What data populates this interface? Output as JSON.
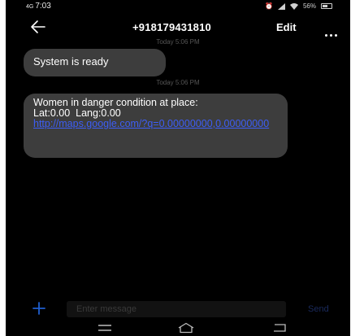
{
  "status_bar": {
    "network": "4G",
    "time": "7:03",
    "battery_text": "56%",
    "battery_level": 0.56
  },
  "header": {
    "contact": "+918179431810",
    "edit_label": "Edit",
    "back_icon": "arrow-left-icon",
    "more_icon": "more-horizontal-icon"
  },
  "messages": [
    {
      "timestamp": "Today 5:06 PM",
      "text": "System is ready"
    },
    {
      "timestamp": "Today 5:06 PM",
      "line1": "Women in danger condition at place:",
      "line2": "Lat:0.00  Lang:0.00",
      "link": "http://maps.google.com/?q=0.00000000,0.00000000"
    }
  ],
  "composer": {
    "placeholder": "Enter message",
    "send_label": "Send",
    "add_icon": "plus-icon"
  },
  "colors": {
    "background": "#000000",
    "bubble": "#3d3d3d",
    "link": "#3d5ef5",
    "accent": "#1f5fd0"
  }
}
